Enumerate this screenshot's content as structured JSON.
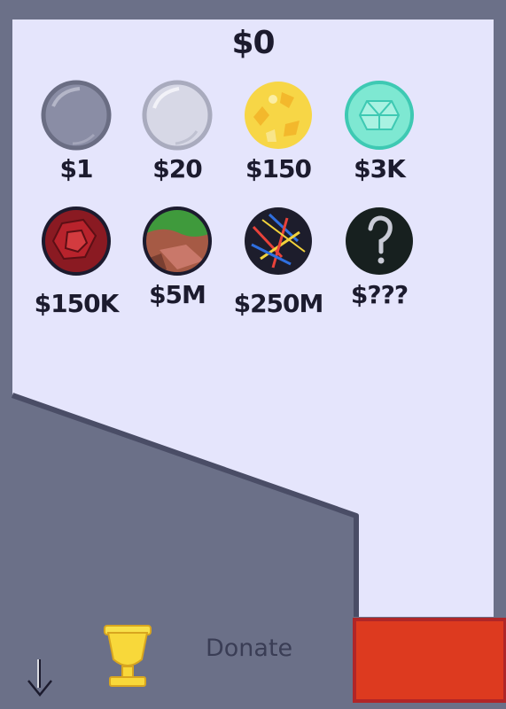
{
  "balance": "$0",
  "shop": {
    "balls": [
      {
        "price": "$1",
        "icon": "gray-ball-icon"
      },
      {
        "price": "$20",
        "icon": "silver-ball-icon"
      },
      {
        "price": "$150",
        "icon": "gold-ball-icon"
      },
      {
        "price": "$3K",
        "icon": "diamond-ball-icon"
      },
      {
        "price": "$150K",
        "icon": "ruby-ball-icon"
      },
      {
        "price": "$5M",
        "icon": "grass-dirt-ball-icon"
      },
      {
        "price": "$250M",
        "icon": "sticks-ball-icon"
      },
      {
        "price": "$???",
        "icon": "mystery-ball-icon"
      }
    ]
  },
  "toolbar": {
    "donate_label": "Donate",
    "trophy_icon": "trophy-icon",
    "drop_icon": "down-arrow-icon"
  },
  "colors": {
    "background": "#6b7088",
    "playfield": "#e5e5fc",
    "action_button": "#dd3a1f",
    "action_button_border": "#b02628"
  }
}
